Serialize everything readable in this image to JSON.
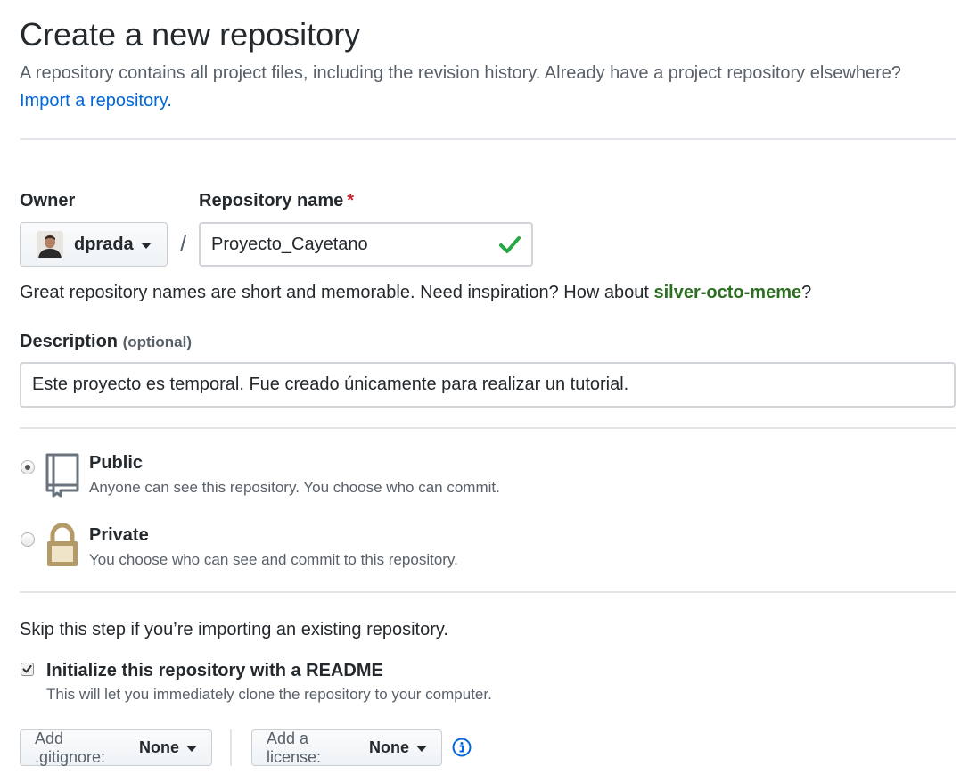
{
  "header": {
    "title": "Create a new repository",
    "subtitle": "A repository contains all project files, including the revision history. Already have a project repository elsewhere?",
    "import_link": "Import a repository."
  },
  "owner": {
    "label": "Owner",
    "value": "dprada"
  },
  "separator": "/",
  "repo_name": {
    "label": "Repository name",
    "required_mark": "*",
    "value": "Proyecto_Cayetano"
  },
  "hint": {
    "text": "Great repository names are short and memorable. Need inspiration? How about ",
    "suggestion": "silver-octo-meme",
    "suffix": "?"
  },
  "description": {
    "label": "Description",
    "optional": "(optional)",
    "value": "Este proyecto es temporal. Fue creado únicamente para realizar un tutorial."
  },
  "visibility": {
    "public": {
      "title": "Public",
      "desc": "Anyone can see this repository. You choose who can commit.",
      "selected": true
    },
    "private": {
      "title": "Private",
      "desc": "You choose who can see and commit to this repository.",
      "selected": false
    }
  },
  "init": {
    "skip_text": "Skip this step if you’re importing an existing repository.",
    "readme_title": "Initialize this repository with a README",
    "readme_desc": "This will let you immediately clone the repository to your computer.",
    "checked": true
  },
  "gitignore": {
    "label": "Add .gitignore:",
    "value": "None"
  },
  "license": {
    "label": "Add a license:",
    "value": "None"
  },
  "colors": {
    "link": "#0366d6",
    "success": "#28a745",
    "required": "#cb2431",
    "suggestion": "#2c6f21"
  },
  "icons": {
    "avatar": "avatar",
    "check": "check-icon",
    "public": "repo-book-icon",
    "private": "lock-icon",
    "info": "info-icon"
  }
}
